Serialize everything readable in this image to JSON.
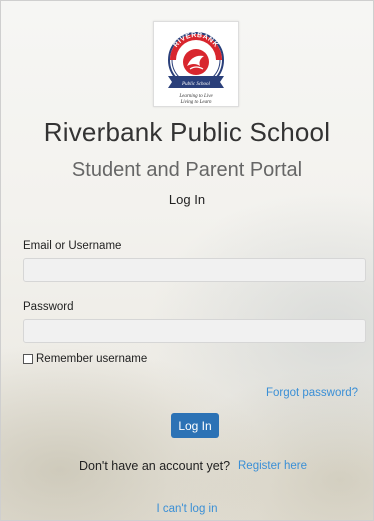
{
  "school": {
    "logo_text": "RIVERBANK",
    "logo_subtext": "Public School",
    "logo_motto_line1": "Learning to Live",
    "logo_motto_line2": "Living to Learn",
    "name": "Riverbank Public School"
  },
  "portal": {
    "title": "Student and Parent Portal",
    "heading": "Log In"
  },
  "form": {
    "username_label": "Email or Username",
    "username_value": "",
    "password_label": "Password",
    "password_value": "",
    "remember_label": "Remember username",
    "remember_checked": false,
    "forgot_link": "Forgot password?",
    "login_button": "Log In"
  },
  "footer": {
    "no_account_text": "Don't have an account yet?",
    "register_link": "Register here",
    "cant_login_link": "I can't log in"
  },
  "colors": {
    "button": "#2c72b5",
    "link": "#3a8fd6",
    "logo_red": "#d8262e",
    "logo_navy": "#2a3f7a"
  }
}
